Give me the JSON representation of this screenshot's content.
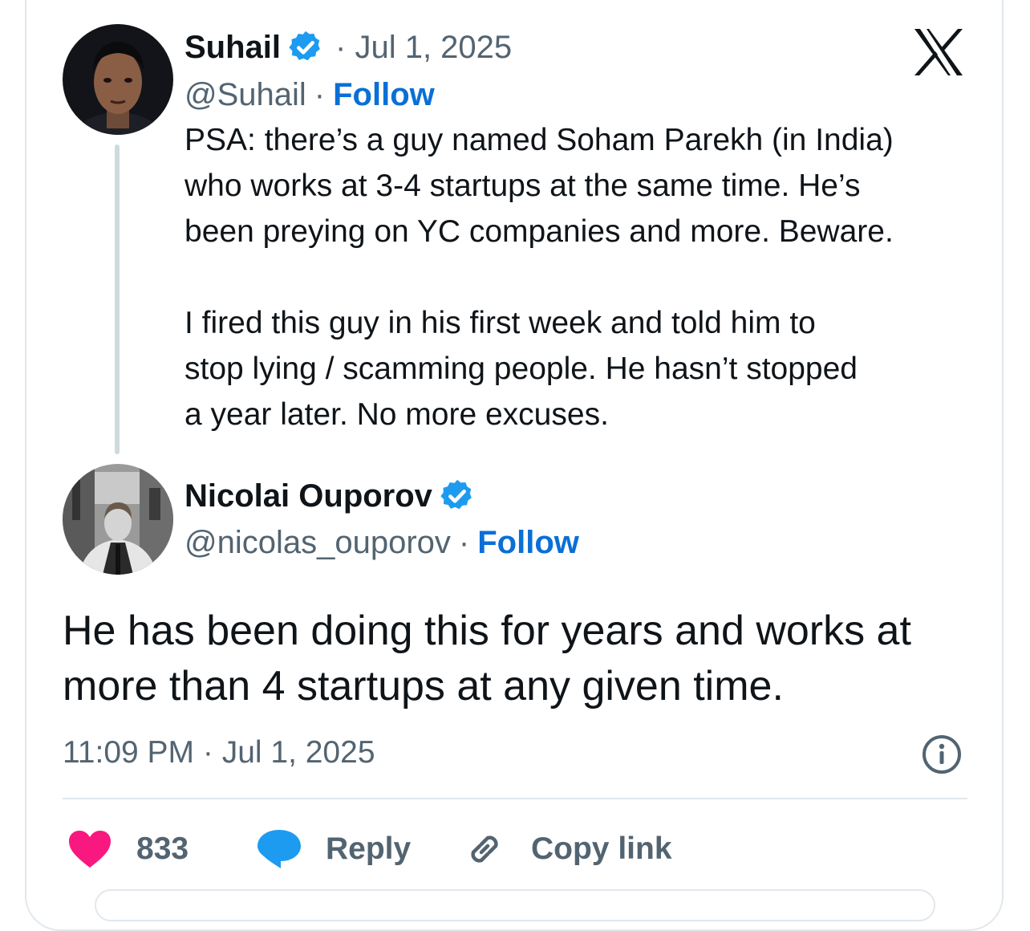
{
  "colors": {
    "accent": "#0a6fd6",
    "verified": "#1d9bf0",
    "like": "#f91880",
    "reply_bubble": "#1d9bf0",
    "muted": "#536471",
    "text": "#0f1419"
  },
  "platform_logo": "x-logo-icon",
  "original_tweet": {
    "author_name": "Suhail",
    "verified": true,
    "date": "· Jul 1, 2025",
    "handle": "@Suhail",
    "separator": "·",
    "follow_label": "Follow",
    "text": "PSA: there’s a guy named Soham Parekh (in India)\nwho works at 3-4 startups at the same time. He’s\nbeen preying on YC companies and more. Beware.\n\nI fired this guy in his first week and told him to\nstop lying / scamming people. He hasn’t stopped\na year later. No more excuses."
  },
  "reply_tweet": {
    "author_name": "Nicolai Ouporov",
    "verified": true,
    "handle": "@nicolas_ouporov",
    "separator": "·",
    "follow_label": "Follow",
    "text": "He has been doing this for years and works at more than 4 startups at any given time.",
    "timestamp": "11:09 PM · Jul 1, 2025",
    "info_icon": "info-icon"
  },
  "actions": {
    "like_count": "833",
    "like_icon": "heart-icon",
    "reply_label": "Reply",
    "reply_icon": "speech-bubble-icon",
    "copy_label": "Copy link",
    "copy_icon": "link-icon"
  }
}
